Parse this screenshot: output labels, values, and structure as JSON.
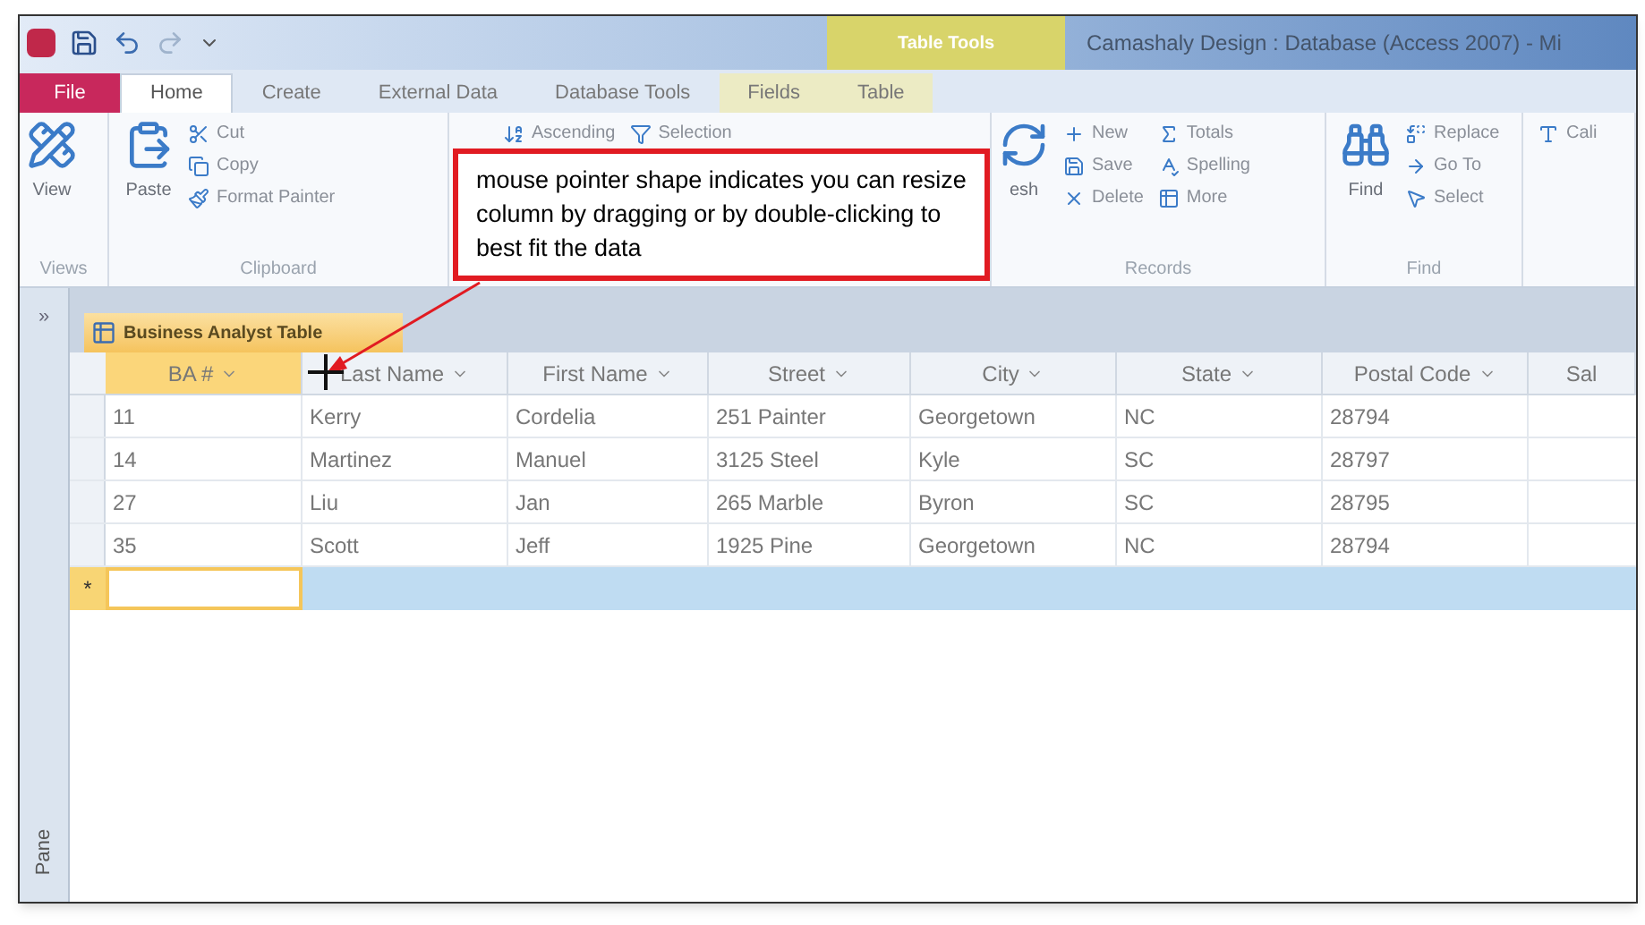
{
  "title_bar": {
    "title": "Camashaly Design : Database (Access 2007) - Mi",
    "contextual_group": "Table Tools"
  },
  "ribbon_tabs": [
    {
      "label": "File",
      "kind": "file",
      "selected": false
    },
    {
      "label": "Home",
      "kind": "tab",
      "selected": true
    },
    {
      "label": "Create",
      "kind": "tab",
      "selected": false
    },
    {
      "label": "External Data",
      "kind": "tab",
      "selected": false
    },
    {
      "label": "Database Tools",
      "kind": "tab",
      "selected": false
    },
    {
      "label": "Fields",
      "kind": "contextual",
      "selected": false
    },
    {
      "label": "Table",
      "kind": "contextual",
      "selected": false
    }
  ],
  "ribbon_groups": [
    {
      "label": "Views",
      "large": [
        "View"
      ]
    },
    {
      "label": "Clipboard",
      "large": [
        "Paste"
      ],
      "small": [
        "Cut",
        "Copy",
        "Format Painter"
      ]
    },
    {
      "small": [
        "Ascending",
        "Selection"
      ]
    },
    {
      "label": "Records",
      "large": [
        "esh"
      ],
      "small": [
        "New",
        "Save",
        "Delete",
        "Totals",
        "Spelling",
        "More"
      ]
    },
    {
      "label": "Find",
      "large": [
        "Find"
      ],
      "small": [
        "Replace",
        "Go To",
        "Select"
      ]
    },
    {
      "small": [
        "Cali"
      ]
    }
  ],
  "callout": {
    "text": "mouse pointer shape indicates you can resize column by dragging or by double-clicking to best fit the data"
  },
  "nav_pane": {
    "toggle": "»",
    "label": "Pane"
  },
  "document_tab": {
    "label": "Business Analyst Table"
  },
  "table": {
    "columns": [
      {
        "label": "BA #",
        "selected": true
      },
      {
        "label": "Last Name",
        "selected": false
      },
      {
        "label": "First Name",
        "selected": false
      },
      {
        "label": "Street",
        "selected": false
      },
      {
        "label": "City",
        "selected": false
      },
      {
        "label": "State",
        "selected": false
      },
      {
        "label": "Postal Code",
        "selected": false
      },
      {
        "label": "Sal",
        "selected": false
      }
    ],
    "rows": [
      [
        "11",
        "Kerry",
        "Cordelia",
        "251 Painter",
        "Georgetown",
        "NC",
        "28794"
      ],
      [
        "14",
        "Martinez",
        "Manuel",
        "3125 Steel",
        "Kyle",
        "SC",
        "28797"
      ],
      [
        "27",
        "Liu",
        "Jan",
        "265 Marble",
        "Byron",
        "SC",
        "28795"
      ],
      [
        "35",
        "Scott",
        "Jeff",
        "1925 Pine",
        "Georgetown",
        "NC",
        "28794"
      ]
    ],
    "new_row": {
      "marker": "*",
      "selected": true
    }
  }
}
